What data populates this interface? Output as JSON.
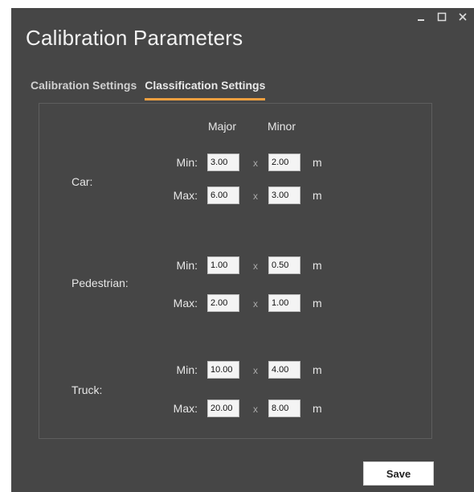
{
  "window": {
    "title": "Calibration Parameters",
    "controls": [
      "minimize-icon",
      "maximize-icon",
      "close-icon"
    ]
  },
  "tabs": [
    {
      "label": "Calibration Settings",
      "active": false
    },
    {
      "label": "Classification Settings",
      "active": true
    }
  ],
  "accent_color": "#f0a040",
  "headers": {
    "major": "Major",
    "minor": "Minor"
  },
  "row_labels": {
    "min": "Min:",
    "max": "Max:"
  },
  "times_symbol": "x",
  "unit": "m",
  "categories": [
    {
      "label": "Car:",
      "min": {
        "major": "3.00",
        "minor": "2.00"
      },
      "max": {
        "major": "6.00",
        "minor": "3.00"
      }
    },
    {
      "label": "Pedestrian:",
      "min": {
        "major": "1.00",
        "minor": "0.50"
      },
      "max": {
        "major": "2.00",
        "minor": "1.00"
      }
    },
    {
      "label": "Truck:",
      "min": {
        "major": "10.00",
        "minor": "4.00"
      },
      "max": {
        "major": "20.00",
        "minor": "8.00"
      }
    }
  ],
  "save_label": "Save"
}
